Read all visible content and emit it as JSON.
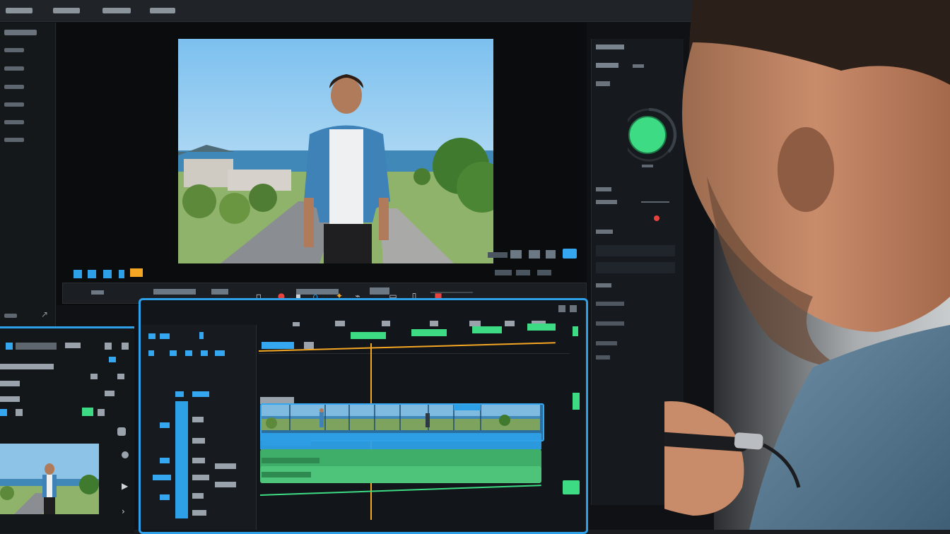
{
  "menu": [
    "",
    "",
    "",
    ""
  ],
  "left_panel": {
    "rows": [
      "",
      "",
      "",
      "",
      "",
      ""
    ]
  },
  "colors": {
    "accent_blue": "#2ea0e8",
    "playhead": "#f5a623",
    "audio_green": "#4dc47a",
    "knob_green": "#3ddc84",
    "record_red": "#e8423f"
  },
  "timeline": {
    "timecode": "",
    "clip_count": 8
  },
  "transport": {
    "icons": [
      "record-icon",
      "play-icon",
      "folder-icon",
      "lock-icon",
      "snap-icon",
      "marker-icon",
      "stop-icon"
    ]
  }
}
